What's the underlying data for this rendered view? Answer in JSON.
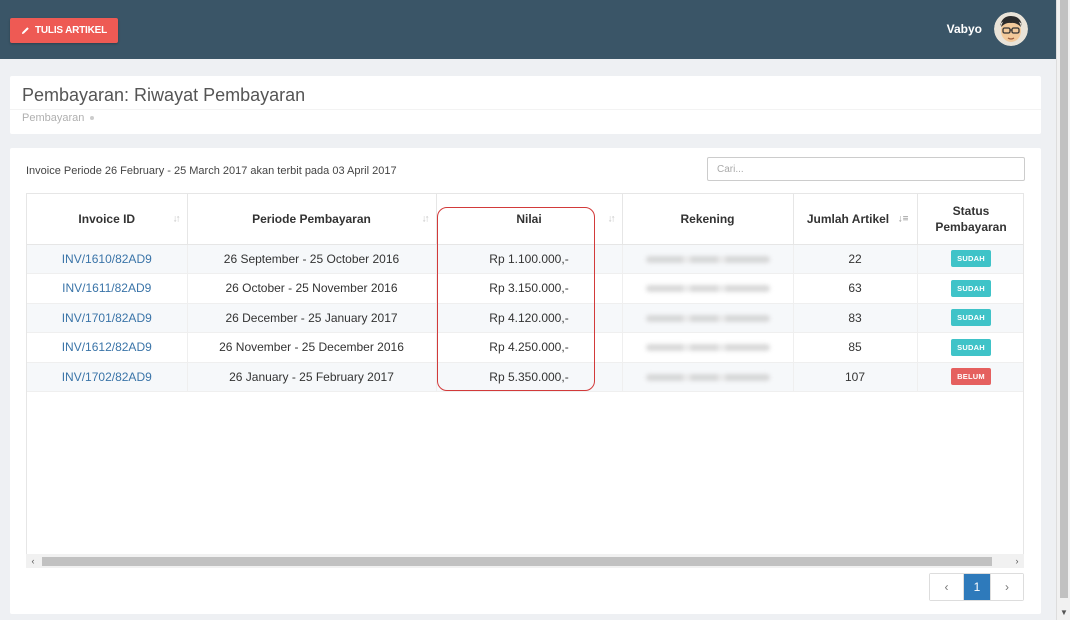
{
  "topbar": {
    "write_button": "TULIS ARTIKEL",
    "user_name": "Vabyo"
  },
  "header": {
    "title": "Pembayaran: Riwayat Pembayaran",
    "breadcrumb": "Pembayaran"
  },
  "main": {
    "info_text": "Invoice Periode 26 February - 25 March 2017 akan terbit pada 03 April 2017",
    "search_placeholder": "Cari...",
    "columns": [
      "Invoice ID",
      "Periode Pembayaran",
      "Nilai",
      "Rekening",
      "Jumlah Artikel",
      "Status Pembayaran"
    ],
    "rows": [
      {
        "invoice_id": "INV/1610/82AD9",
        "periode": "26 September - 25 October 2016",
        "nilai": "Rp 1.100.000,-",
        "jumlah": "22",
        "status": "SUDAH"
      },
      {
        "invoice_id": "INV/1611/82AD9",
        "periode": "26 October - 25 November 2016",
        "nilai": "Rp 3.150.000,-",
        "jumlah": "63",
        "status": "SUDAH"
      },
      {
        "invoice_id": "INV/1701/82AD9",
        "periode": "26 December - 25 January 2017",
        "nilai": "Rp 4.120.000,-",
        "jumlah": "83",
        "status": "SUDAH"
      },
      {
        "invoice_id": "INV/1612/82AD9",
        "periode": "26 November - 25 December 2016",
        "nilai": "Rp 4.250.000,-",
        "jumlah": "85",
        "status": "SUDAH"
      },
      {
        "invoice_id": "INV/1702/82AD9",
        "periode": "26 January - 25 February 2017",
        "nilai": "Rp 5.350.000,-",
        "jumlah": "107",
        "status": "BELUM"
      }
    ],
    "pagination": {
      "prev": "‹",
      "current": "1",
      "next": "›"
    }
  },
  "colors": {
    "topbar": "#3a5567",
    "accent": "#ee5a54",
    "link": "#3a74a8",
    "status_paid": "#3fc3c8",
    "status_unpaid": "#e5605f",
    "page_active": "#2e7abb"
  }
}
